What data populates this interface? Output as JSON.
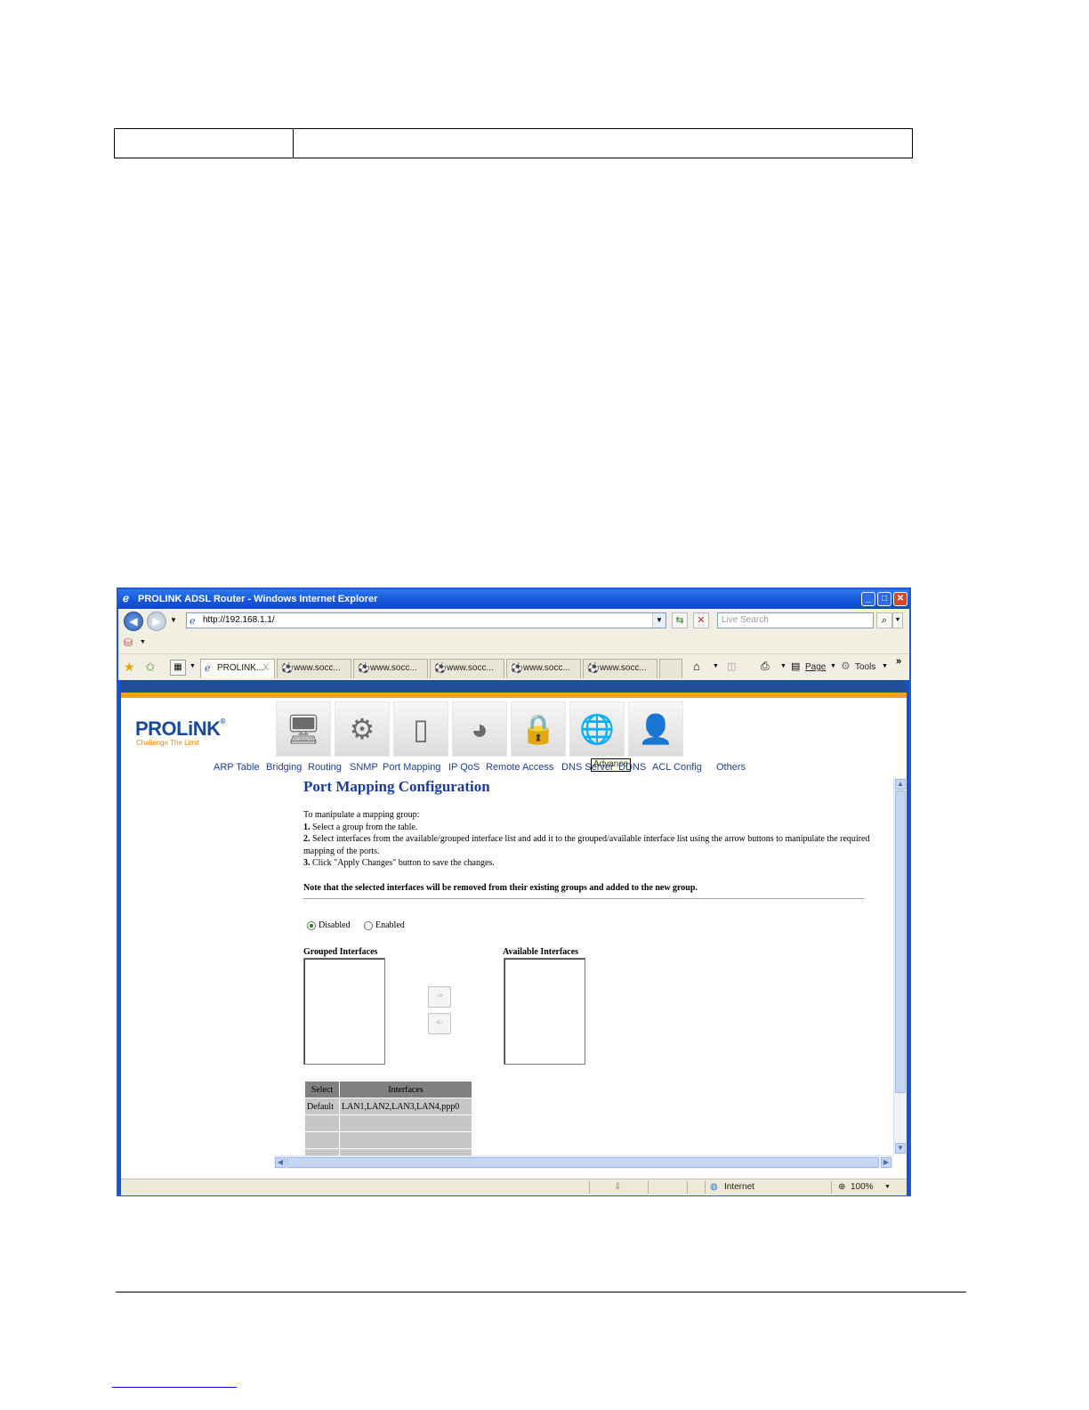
{
  "window": {
    "title": "PROLINK ADSL Router - Windows Internet Explorer",
    "address": "http://192.168.1.1/",
    "search_placeholder": "Live Search"
  },
  "tabs": [
    {
      "label": "PROLINK..."
    },
    {
      "label": "www.socc..."
    },
    {
      "label": "www.socc..."
    },
    {
      "label": "www.socc..."
    },
    {
      "label": "www.socc..."
    },
    {
      "label": "www.socc..."
    }
  ],
  "tab_close": "X",
  "toolbar": {
    "page": "Page",
    "tools": "Tools",
    "more": "»"
  },
  "brand": {
    "logo": "PROLiNK",
    "slogan": "Challenge The Limit"
  },
  "tooltip": "Advance",
  "subnav": [
    "ARP Table",
    "Bridging",
    "Routing",
    "SNMP",
    "Port Mapping",
    "IP QoS",
    "Remote Access",
    "DNS Server",
    "DDNS",
    "ACL Config",
    "Others"
  ],
  "page": {
    "title": "Port Mapping Configuration",
    "intro": "To manipulate a mapping group:",
    "steps": [
      {
        "num": "1.",
        "text": " Select a group from the table."
      },
      {
        "num": "2.",
        "text": " Select interfaces from the available/grouped interface list and add it to the grouped/available interface list using the arrow buttons to manipulate the required mapping of the ports."
      },
      {
        "num": "3.",
        "text": " Click \"Apply Changes\" button to save the changes."
      }
    ],
    "note": "Note that the selected interfaces will be removed from their existing groups and added to the new group.",
    "radio_disabled": "Disabled",
    "radio_enabled": "Enabled",
    "grouped_label": "Grouped Interfaces",
    "available_label": "Available Interfaces",
    "add_button": "->",
    "remove_button": "<-",
    "table": {
      "headers": [
        "Select",
        "Interfaces"
      ],
      "rows": [
        [
          "Default",
          "LAN1,LAN2,LAN3,LAN4,ppp0"
        ],
        [
          "",
          ""
        ],
        [
          "",
          ""
        ],
        [
          "",
          ""
        ]
      ]
    }
  },
  "status": {
    "zone": "Internet",
    "zoom": "100%"
  }
}
